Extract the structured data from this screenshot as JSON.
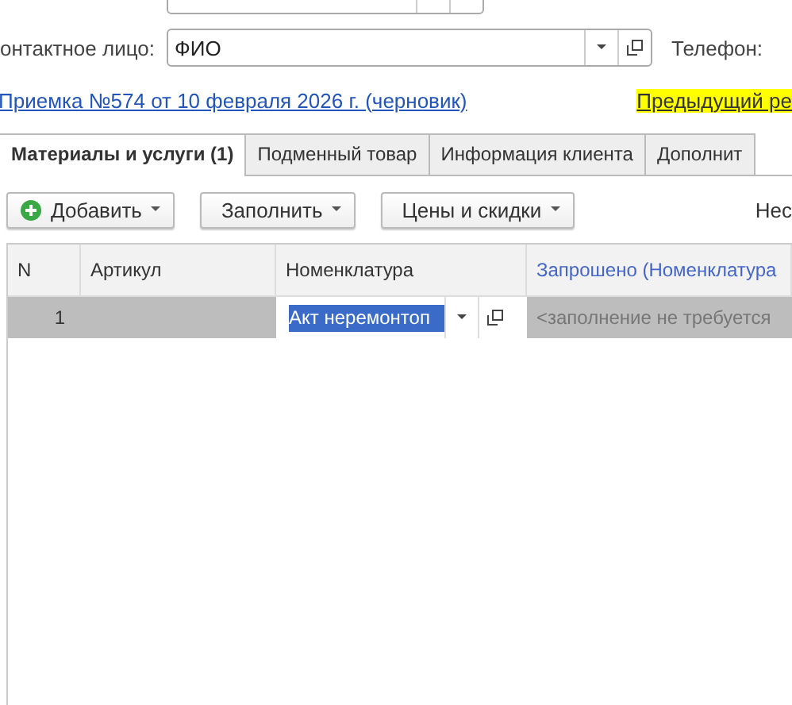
{
  "contact": {
    "label": "онтактное лицо:",
    "value": "ФИО",
    "phone_label": "Телефон:"
  },
  "links": {
    "document": "Приемка №574 от 10 февраля 2026 г. (черновик)",
    "previous": "Предыдущий ре"
  },
  "tabs": [
    {
      "label": "Материалы и услуги (1)",
      "selected": true
    },
    {
      "label": "Подменный товар",
      "selected": false
    },
    {
      "label": "Информация клиента",
      "selected": false
    },
    {
      "label": "Дополнит",
      "selected": false
    }
  ],
  "toolbar": {
    "buttons": [
      {
        "label": "Добавить",
        "kind": "add"
      },
      {
        "label": "Заполнить",
        "kind": "menu"
      },
      {
        "label": "Цены и скидки",
        "kind": "menu"
      }
    ],
    "right_text": "Нес"
  },
  "table": {
    "columns": [
      {
        "label": "N",
        "kind": "plain"
      },
      {
        "label": "Артикул",
        "kind": "plain"
      },
      {
        "label": "Номенклатура",
        "kind": "plain"
      },
      {
        "label": "Запрошено (Номенклатура",
        "kind": "link"
      }
    ],
    "rows": [
      {
        "n": "1",
        "article": "",
        "item": "Акт неремонтоп",
        "requested": "<заполнение не требуется",
        "selected": true
      }
    ]
  }
}
